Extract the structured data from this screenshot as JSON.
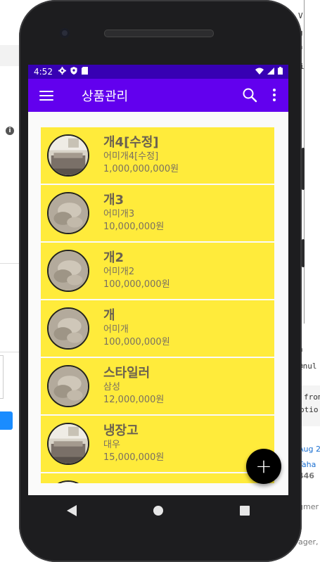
{
  "status_bar": {
    "time": "4:52"
  },
  "app_bar": {
    "title": "상품관리"
  },
  "products": [
    {
      "name": "개4[수정]",
      "description": "어미개4[수정]",
      "price": "1,000,000,000원",
      "thumbnail": "room-photo"
    },
    {
      "name": "개3",
      "description": "어미개3",
      "price": "10,000,000원",
      "thumbnail": "blurred-photo"
    },
    {
      "name": "개2",
      "description": "어미개2",
      "price": "100,000,000원",
      "thumbnail": "blurred-photo"
    },
    {
      "name": "개",
      "description": "어미개",
      "price": "100,000,000원",
      "thumbnail": "blurred-photo"
    },
    {
      "name": "스타일러",
      "description": "삼성",
      "price": "12,000,000원",
      "thumbnail": "blurred-photo"
    },
    {
      "name": "냉장고",
      "description": "대우",
      "price": "15,000,000원",
      "thumbnail": "room-photo"
    },
    {
      "name": "",
      "description": "",
      "price": "",
      "thumbnail": "room-photo"
    }
  ],
  "fab": {
    "label": "+"
  },
  "colors": {
    "status_bar": "#3700b3",
    "app_bar": "#6200ee",
    "list_item": "#ffeb3b",
    "fab": "#000000"
  },
  "icons": {
    "menu": "menu-icon",
    "search": "search-icon",
    "more": "more-vert-icon",
    "add": "add-icon",
    "back": "back-triangle-icon",
    "home": "home-circle-icon",
    "recents": "recents-square-icon"
  },
  "background_fragments": {
    "right": [
      "V",
      "g",
      "a",
      "i",
      "n",
      "@nul",
      "from",
      "ptio",
      "Aug 2",
      "Taha",
      "446",
      "gmer",
      "ager,"
    ]
  }
}
